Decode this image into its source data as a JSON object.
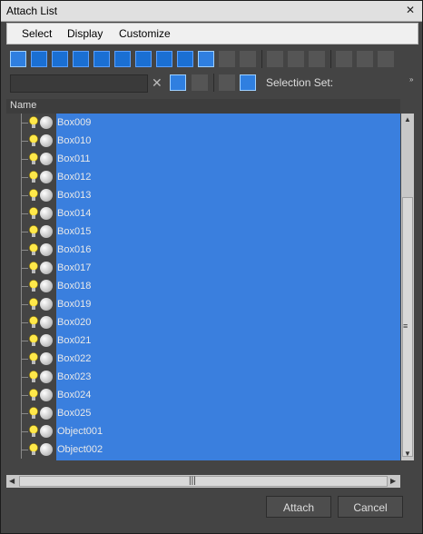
{
  "window": {
    "title": "Attach List",
    "close_glyph": "✕"
  },
  "menu": [
    "Select",
    "Display",
    "Customize"
  ],
  "toolbar": {
    "selection_set_label": "Selection Set:",
    "search_placeholder": ""
  },
  "columns": {
    "name": "Name"
  },
  "objects": [
    "Box009",
    "Box010",
    "Box011",
    "Box012",
    "Box013",
    "Box014",
    "Box015",
    "Box016",
    "Box017",
    "Box018",
    "Box019",
    "Box020",
    "Box021",
    "Box022",
    "Box023",
    "Box024",
    "Box025",
    "Object001",
    "Object002"
  ],
  "buttons": {
    "attach": "Attach",
    "cancel": "Cancel"
  },
  "colors": {
    "selection": "#3a7fde",
    "panel": "#444444"
  }
}
